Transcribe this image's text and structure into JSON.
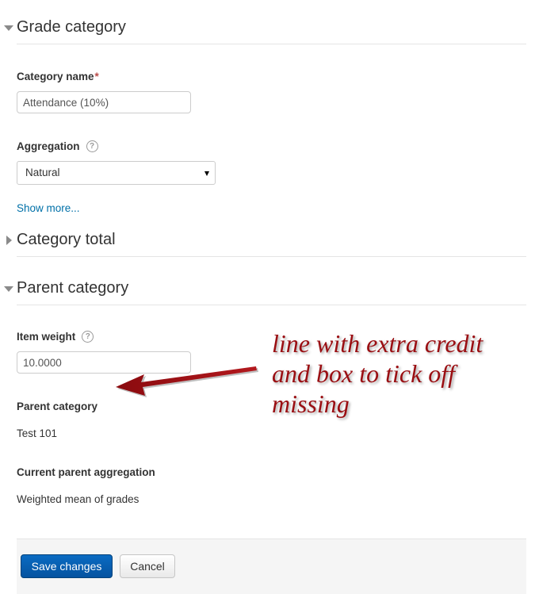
{
  "sections": {
    "grade_category": {
      "title": "Grade category",
      "expanded": true
    },
    "category_total": {
      "title": "Category total",
      "expanded": false
    },
    "parent_category": {
      "title": "Parent category",
      "expanded": true
    }
  },
  "fields": {
    "category_name": {
      "label": "Category name",
      "required_mark": "*",
      "value": "Attendance (10%)"
    },
    "aggregation": {
      "label": "Aggregation",
      "selected": "Natural",
      "help_icon": "help-icon"
    },
    "show_more": "Show more...",
    "item_weight": {
      "label": "Item weight",
      "value": "10.0000",
      "help_icon": "help-icon"
    },
    "parent_category": {
      "label": "Parent category",
      "value": "Test 101"
    },
    "current_parent_aggregation": {
      "label": "Current parent aggregation",
      "value": "Weighted mean of grades"
    }
  },
  "annotation": {
    "lines": [
      "line with extra credit",
      "and box to tick off",
      "missing"
    ],
    "color": "#9a0e12"
  },
  "buttons": {
    "save": "Save changes",
    "cancel": "Cancel"
  },
  "colors": {
    "link": "#0070a8",
    "primary_button": "#0553a0",
    "required": "#b94a48"
  }
}
